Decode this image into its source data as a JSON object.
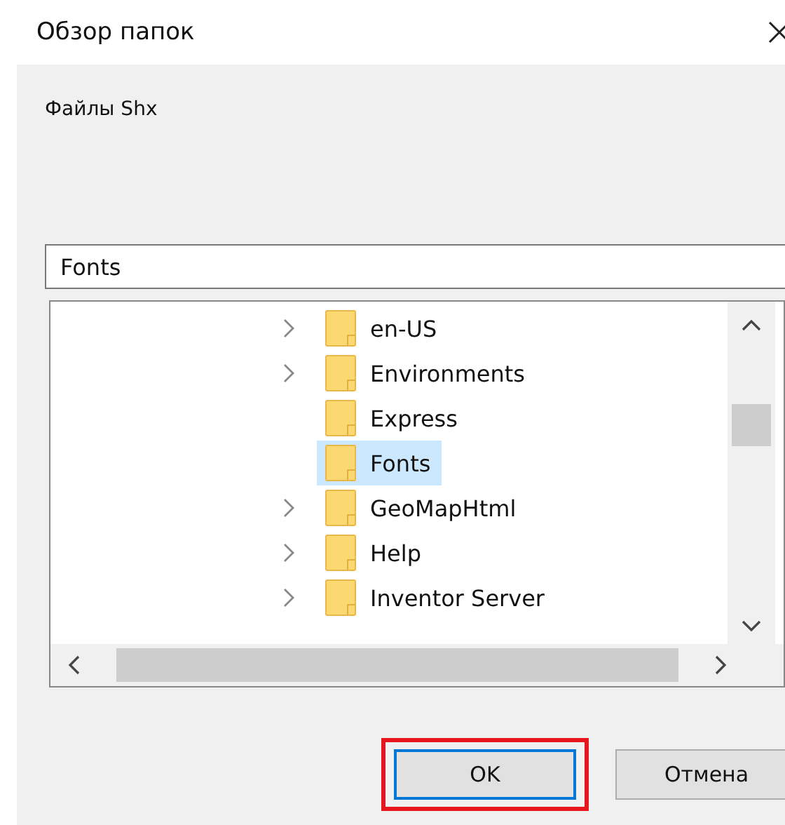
{
  "window": {
    "title": "Обзор папок"
  },
  "description": "Файлы Shx",
  "folder_field": {
    "value": "Fonts"
  },
  "tree": {
    "items": [
      {
        "label": "en-US",
        "expandable": true,
        "selected": false
      },
      {
        "label": "Environments",
        "expandable": true,
        "selected": false
      },
      {
        "label": "Express",
        "expandable": false,
        "selected": false
      },
      {
        "label": "Fonts",
        "expandable": false,
        "selected": true
      },
      {
        "label": "GeoMapHtml",
        "expandable": true,
        "selected": false
      },
      {
        "label": "Help",
        "expandable": true,
        "selected": false
      },
      {
        "label": "Inventor Server",
        "expandable": true,
        "selected": false
      }
    ]
  },
  "buttons": [
    {
      "label": "OK",
      "kind": "default",
      "highlighted": true
    },
    {
      "label": "Отмена",
      "kind": "normal",
      "highlighted": false
    }
  ]
}
